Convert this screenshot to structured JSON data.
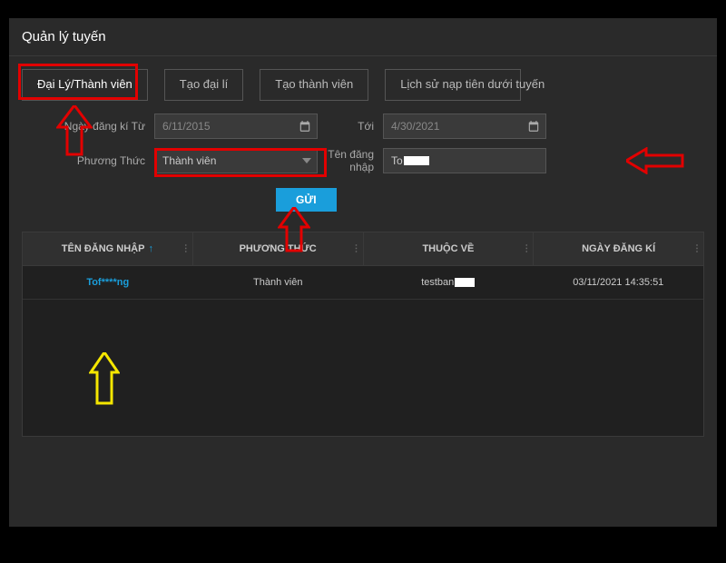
{
  "header": {
    "title": "Quản lý tuyến"
  },
  "tabs": {
    "t1": "Đại Lý/Thành viên",
    "t2": "Tạo đại lí",
    "t3": "Tạo thành viên",
    "t4": "Lịch sử nạp tiên dưới tuyến"
  },
  "filters": {
    "date_from_label": "Ngày đăng kí Từ",
    "date_from_value": "6/11/2015",
    "date_to_label": "Tới",
    "date_to_value": "4/30/2021",
    "method_label": "Phương Thức",
    "method_value": "Thành viên",
    "login_label": "Tên đăng nhập",
    "login_value_prefix": "To",
    "submit": "GỬI"
  },
  "table": {
    "columns": {
      "c1": "TÊN ĐĂNG NHẬP",
      "c2": "PHƯƠNG THỨC",
      "c3": "THUỘC VỀ",
      "c4": "NGÀY ĐĂNG KÍ"
    },
    "row1": {
      "login": "Tof****ng",
      "method": "Thành viên",
      "belong_prefix": "testban",
      "date": "03/11/2021 14:35:51"
    }
  }
}
